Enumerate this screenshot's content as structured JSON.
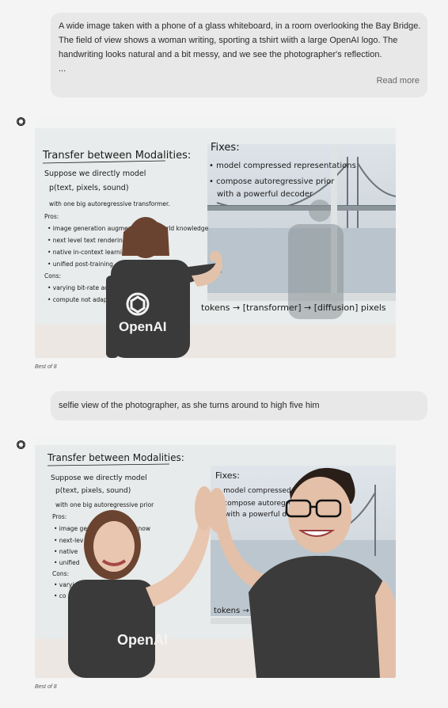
{
  "conversation": {
    "prompt_1": {
      "lines": [
        "A wide image taken with a phone of a glass whiteboard, in a room overlooking the Bay Bridge.",
        "The field of view shows a woman writing, sporting a tshirt wiith a large OpenAI logo. The",
        "handwriting looks natural and a bit messy, and we see the photographer's reflection.",
        "..."
      ],
      "read_more": "Read more"
    },
    "response_1": {
      "caption": "Best of 8"
    },
    "prompt_2": {
      "text": "selfie view of the photographer, as she turns around to high five him"
    },
    "response_2": {
      "caption": "Best of 8"
    }
  },
  "whiteboard_1": {
    "title": "Transfer between Modalities:",
    "left_lines": [
      "Suppose we directly model",
      "p(text, pixels, sound)",
      "with one big autoregressive transformer.",
      "Pros:",
      "• image generation augmented with world knowledge",
      "• next level text rendering",
      "• native in-context learning",
      "• unified post-training",
      "Cons:",
      "• varying bit-rate across modalities",
      "• compute not adaptive"
    ],
    "fixes_title": "Fixes:",
    "fixes_lines": [
      "• model compressed representations",
      "• compose autoregressive prior",
      "with a powerful decoder"
    ],
    "pipeline": "tokens → [transformer] → [diffusion] pixels",
    "shirt_text": "OpenAI"
  },
  "whiteboard_2": {
    "title": "Transfer between Modalities:",
    "left_lines": [
      "Suppose we directly model",
      "p(text, pixels, sound)",
      "with one big autoregressive prior",
      "Pros:",
      "• image gen   ed with world know",
      "• next-lev",
      "• native",
      "• unified",
      "Cons:",
      "• varyin",
      "• co"
    ],
    "fixes_title": "Fixes:",
    "fixes_lines": [
      "• model compressed rep",
      "• compose autoregress",
      "with a powerful d"
    ],
    "pipeline": "tokens → (tra",
    "shirt_text": "OpenAI"
  },
  "colors": {
    "page_bg": "#f4f4f4",
    "bubble_bg": "#e8e8e8",
    "shirt": "#3a3a3a",
    "water": "#c9d3db"
  },
  "icons": {
    "assistant": "openai-logo-icon"
  }
}
